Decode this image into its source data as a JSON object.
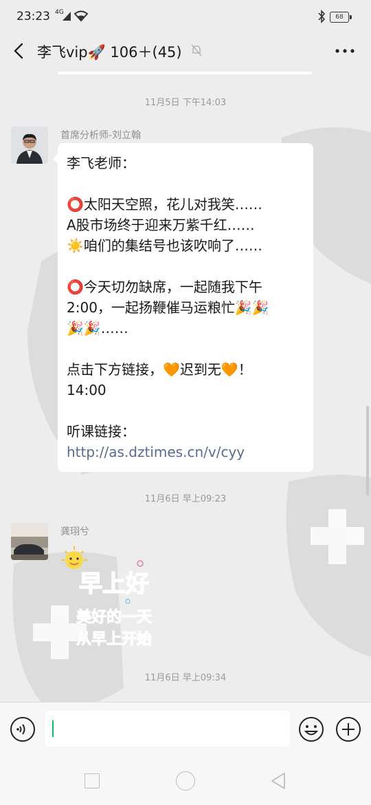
{
  "status_bar": {
    "time": "23:23",
    "network": "4G",
    "battery": "68"
  },
  "header": {
    "title": "李飞vip🚀 106＋(45)"
  },
  "messages": [
    {
      "timestamp": "11月5日 下午14:03",
      "sender": "首席分析师-刘立翰",
      "lines": [
        "李飞老师：",
        "",
        "⭕太阳天空照，花儿对我笑……",
        "A股市场终于迎来万紫千红……",
        "☀️咱们的集结号也该吹响了……",
        "",
        "⭕今天切勿缺席，一起随我下午",
        "2:00，一起扬鞭催马运粮忙🎉🎉",
        "🎉🎉……",
        "",
        "点击下方链接，🧡迟到无🧡！",
        "14:00",
        "",
        "听课链接："
      ],
      "link": "http://as.dztimes.cn/v/cyy"
    },
    {
      "timestamp": "11月6日 早上09:23",
      "sender": "龚珝兮",
      "sticker": {
        "line1": "早上好",
        "line2": "美好的一天",
        "line3": "从早上开始"
      }
    },
    {
      "timestamp": "11月6日 早上09:34"
    }
  ],
  "colors": {
    "background": "#ededed",
    "bubble": "#ffffff",
    "link": "#576b95",
    "cursor": "#07c160"
  },
  "icons": [
    "back-arrow-icon",
    "mute-bell-icon",
    "more-icon",
    "voice-icon",
    "emoji-icon",
    "plus-icon",
    "bluetooth-icon",
    "wifi-icon",
    "signal-icon"
  ]
}
